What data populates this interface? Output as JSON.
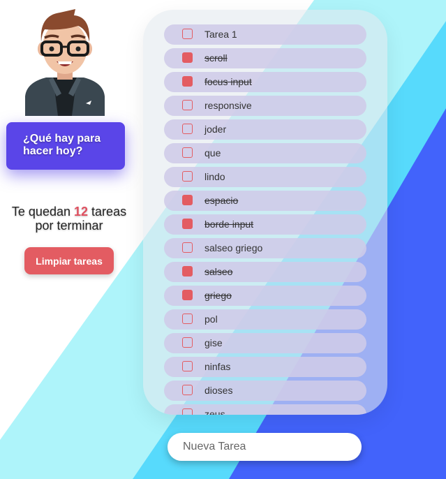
{
  "prompt": {
    "line1": "¿Qué hay para",
    "line2": "hacer hoy?"
  },
  "remaining": {
    "prefix": "Te quedan",
    "count": "12",
    "suffix": "tareas",
    "line2": "por terminar"
  },
  "clear_button": "Limpiar tareas",
  "tasks": [
    {
      "label": "Tarea 1",
      "done": false
    },
    {
      "label": "scroll",
      "done": true
    },
    {
      "label": "focus input",
      "done": true
    },
    {
      "label": "responsive",
      "done": false
    },
    {
      "label": "joder",
      "done": false
    },
    {
      "label": "que",
      "done": false
    },
    {
      "label": "lindo",
      "done": false
    },
    {
      "label": "espacio",
      "done": true
    },
    {
      "label": "borde input",
      "done": true
    },
    {
      "label": "salseo griego",
      "done": false
    },
    {
      "label": "salseo",
      "done": true
    },
    {
      "label": "griego",
      "done": true
    },
    {
      "label": "pol",
      "done": false
    },
    {
      "label": "gise",
      "done": false
    },
    {
      "label": "ninfas",
      "done": false
    },
    {
      "label": "dioses",
      "done": false
    },
    {
      "label": "zeus",
      "done": false
    }
  ],
  "new_task": {
    "placeholder": "Nueva Tarea"
  },
  "colors": {
    "accent": "#e35c62",
    "prompt_bg": "#5a45e8",
    "bg_cyan": "#aef4fa",
    "bg_sky": "#57dafc",
    "bg_blue": "#4263fb"
  },
  "icons": {
    "avatar": "avatar-man-glasses"
  }
}
